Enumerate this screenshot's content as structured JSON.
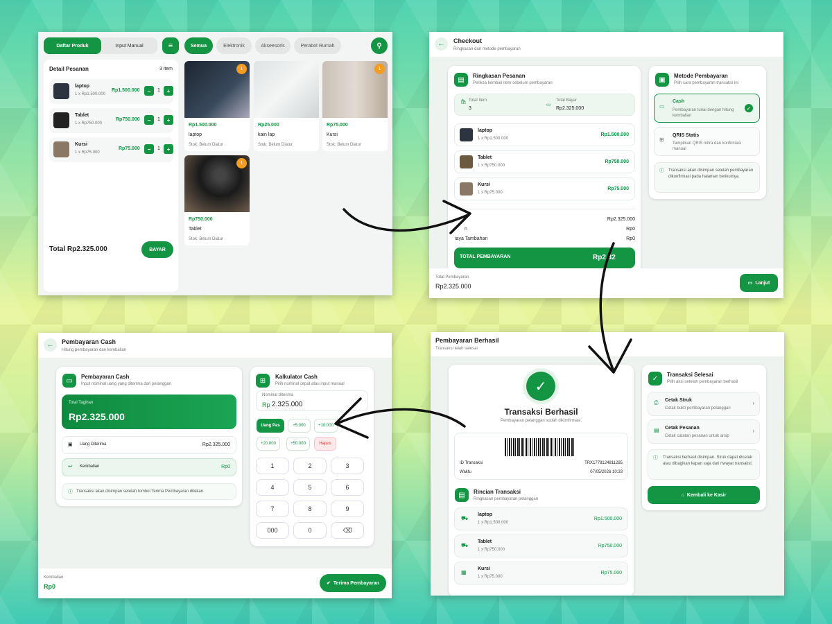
{
  "pos": {
    "tabs": [
      "Daftar Produk",
      "Input Manual"
    ],
    "categories": [
      "Semua",
      "Elektronik",
      "Akseesoris",
      "Perabot Rumah"
    ],
    "order_title": "Detail Pesanan",
    "order_count": "3 item",
    "order_items": [
      {
        "name": "laptop",
        "sub": "1 x Rp1.500.000",
        "price": "Rp1.500.000",
        "qty": "1"
      },
      {
        "name": "Tablet",
        "sub": "1 x Rp750.000",
        "price": "Rp750.000",
        "qty": "1"
      },
      {
        "name": "Kursi",
        "sub": "1 x Rp75.000",
        "price": "Rp75.000",
        "qty": "1"
      }
    ],
    "total": "Total Rp2.325.000",
    "pay_button": "BAYAR",
    "products": [
      {
        "price": "Rp1.500.000",
        "name": "laptop",
        "stock": "Stok: Belum Diatur",
        "badge": "1"
      },
      {
        "price": "Rp25.000",
        "name": "kain lap",
        "stock": "Stok: Belum Diatur",
        "badge": ""
      },
      {
        "price": "Rp75.000",
        "name": "Kursi",
        "stock": "Stok: Belum Diatur",
        "badge": "1"
      },
      {
        "price": "Rp750.000",
        "name": "Tablet",
        "stock": "Stok: Belum Diatur",
        "badge": "1"
      }
    ]
  },
  "checkout": {
    "title": "Checkout",
    "subtitle": "Ringkasan dan metode pembayaran",
    "summary_title": "Ringkasan Pesanan",
    "summary_sub": "Periksa kembali item sebelum pembayaran",
    "total_item_label": "Total Item",
    "total_item_value": "3",
    "total_bayar_label": "Total Bayar",
    "total_bayar_value": "Rp2.325.000",
    "items": [
      {
        "name": "laptop",
        "sub": "1 x Rp1.500.000",
        "price": "Rp1.500.000"
      },
      {
        "name": "Tablet",
        "sub": "1 x Rp750.000",
        "price": "Rp750.000"
      },
      {
        "name": "Kursi",
        "sub": "1 x Rp75.000",
        "price": "Rp75.000"
      }
    ],
    "subtotal_value": "Rp2.325.000",
    "discount_label": "n",
    "discount_value": "Rp0",
    "extra_label": "iaya Tambahan",
    "extra_value": "Rp0",
    "grand_label": "TOTAL PEMBAYARAN",
    "grand_value": "Rp2.32",
    "method_title": "Metode Pembayaran",
    "method_sub": "Pilih cara pembayaran transaksi ini",
    "cash_title": "Cash",
    "cash_sub": "Pembayaran tunai dengan hitung kembalian",
    "qris_title": "QRIS Statis",
    "qris_sub": "Tampilkan QRIS mitra dan konfirmasi manual",
    "info": "Transaksi akan disimpan setelah pembayaran dikonfirmasi pada halaman berikutnya.",
    "footer_label": "Total Pembayaran",
    "footer_value": "Rp2.325.000",
    "next_button": "Lanjut"
  },
  "success": {
    "title": "Pembayaran Berhasil",
    "subtitle": "Transaksi telah selesai",
    "heading": "Transaksi Berhasil",
    "message": "Pembayaran pelanggan sudah dikonfirmasi.",
    "id_label": "ID Transaksi",
    "id_value": "TRX1778124811285",
    "time_label": "Waktu",
    "time_value": "07/05/2026 10:33",
    "detail_title": "Rincian Transaksi",
    "detail_sub": "Ringkasan pembayaran pelanggan",
    "items": [
      {
        "name": "laptop",
        "sub": "1 x Rp1.500.000",
        "price": "Rp1.500.000"
      },
      {
        "name": "Tablet",
        "sub": "1 x Rp750.000",
        "price": "Rp750.000"
      },
      {
        "name": "Kursi",
        "sub": "1 x Rp75.000",
        "price": "Rp75.000"
      }
    ],
    "done_title": "Transaksi Selesai",
    "done_sub": "Pilih aksi setelah pembayaran berhasil",
    "print_title": "Cetak Struk",
    "print_sub": "Cetak bukti pembayaran pelanggan",
    "order_title": "Cetak Pesanan",
    "order_sub": "Cetak catatan pesanan untuk arsip",
    "info": "Transaksi berhasil disimpan. Struk dapat dicetak atau dibagikan kapan saja dari riwayat transaksi.",
    "back_button": "Kembali ke Kasir"
  },
  "cash": {
    "title": "Pembayaran Cash",
    "subtitle": "Hitung pembayaran dan kembalian",
    "card_title": "Pembayaran Cash",
    "card_sub": "Input nominal uang yang diterima dari pelanggan",
    "bill_label": "Total Tagihan",
    "bill_value": "Rp2.325.000",
    "received_label": "Uang Diterima",
    "received_value": "Rp2.325.000",
    "change_label": "Kembalian",
    "change_value": "Rp0",
    "info": "Transaksi akan disimpan setelah tombol Terima Pembayaran ditekan.",
    "calc_title": "Kalkulator Cash",
    "calc_sub": "Pilih nominal cepat atau input manual",
    "nominal_label": "Nominal diterima",
    "nominal_prefix": "Rp",
    "nominal_value": "2.325.000",
    "quick": [
      "Uang Pas",
      "+5.000",
      "+10.000",
      "+20.000",
      "+50.000",
      "Hapus"
    ],
    "keys": [
      "1",
      "2",
      "3",
      "4",
      "5",
      "6",
      "7",
      "8",
      "9",
      "000",
      "0"
    ],
    "footer_label": "Kembalian",
    "footer_value": "Rp0",
    "accept_button": "Terima Pembayaran"
  },
  "colors": {
    "accent": "#139544"
  }
}
